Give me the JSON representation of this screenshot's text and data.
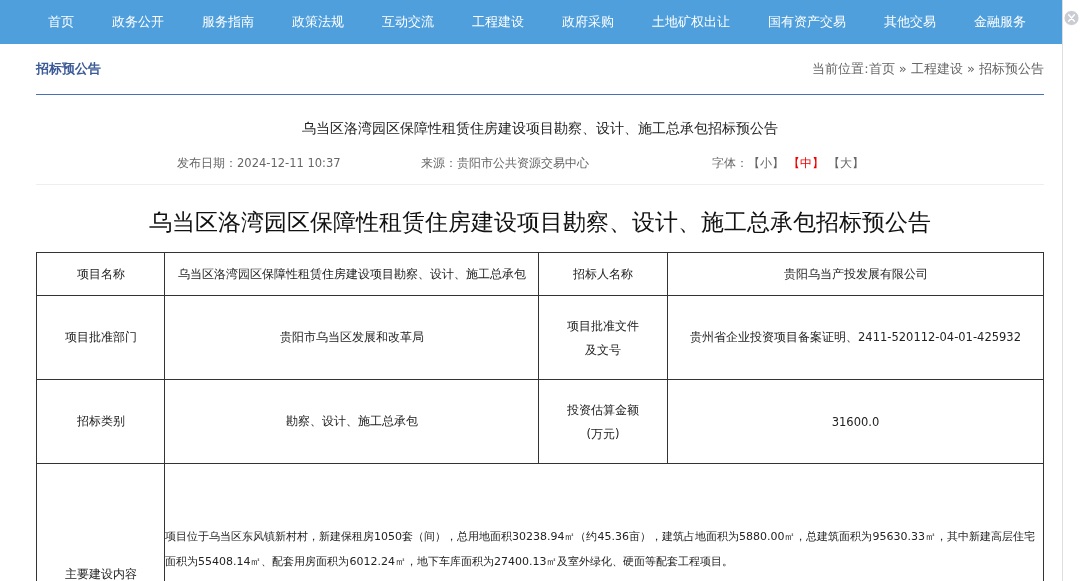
{
  "nav": [
    {
      "label": "首页"
    },
    {
      "label": "政务公开"
    },
    {
      "label": "服务指南"
    },
    {
      "label": "政策法规"
    },
    {
      "label": "互动交流"
    },
    {
      "label": "工程建设"
    },
    {
      "label": "政府采购"
    },
    {
      "label": "土地矿权出让"
    },
    {
      "label": "国有资产交易"
    },
    {
      "label": "其他交易"
    },
    {
      "label": "金融服务"
    }
  ],
  "section_title": "招标预公告",
  "breadcrumb": "当前位置:首页 » 工程建设 » 招标预公告",
  "article_title": "乌当区洛湾园区保障性租赁住房建设项目勘察、设计、施工总承包招标预公告",
  "meta": {
    "date": "发布日期：2024-12-11 10:37",
    "source": "来源：贵阳市公共资源交易中心",
    "font_label": "字体：",
    "font_sizes": [
      {
        "label": "【小】",
        "selected": false
      },
      {
        "label": "【中】",
        "selected": true
      },
      {
        "label": "【大】",
        "selected": false
      }
    ]
  },
  "heading": "乌当区洛湾园区保障性租赁住房建设项目勘察、设计、施工总承包招标预公告",
  "table": [
    {
      "kind": "pair",
      "cells": [
        "项目名称",
        "乌当区洛湾园区保障性租赁住房建设项目勘察、设计、施工总承包",
        "招标人名称",
        "贵阳乌当产投发展有限公司"
      ]
    },
    {
      "kind": "pair",
      "cells": [
        "项目批准部门",
        "贵阳市乌当区发展和改革局",
        "项目批准文件及文号",
        "贵州省企业投资项目备案证明、2411-520112-04-01-425932"
      ]
    },
    {
      "kind": "pair",
      "cells": [
        "招标类别",
        "勘察、设计、施工总承包",
        "投资估算金额(万元)",
        "31600.0"
      ]
    },
    {
      "kind": "wide",
      "cells": [
        "主要建设内容",
        "项目位于乌当区东风镇新村村，新建保租房1050套（间），总用地面积30238.94㎡（约45.36亩），建筑占地面积为5880.00㎡，总建筑面积为95630.33㎡，其中新建高层住宅面积为55408.14㎡、配套用房面积为6012.24㎡，地下车库面积为27400.13㎡及室外绿化、硬面等配套工程项目。"
      ]
    }
  ]
}
